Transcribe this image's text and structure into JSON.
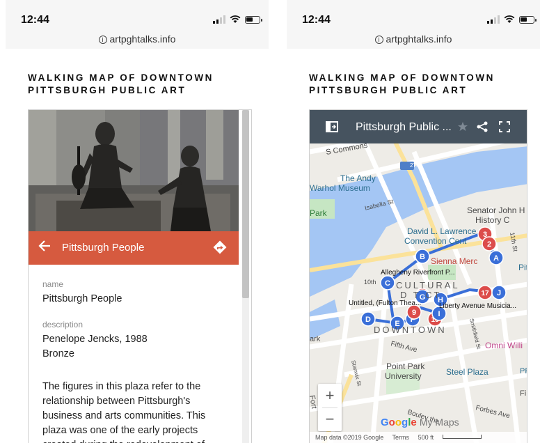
{
  "status": {
    "time": "12:44",
    "url": "artpghtalks.info"
  },
  "page": {
    "heading": "WALKING MAP OF DOWNTOWN PITTSBURGH PUBLIC ART"
  },
  "card": {
    "title": "Pittsburgh People",
    "name_label": "name",
    "name_value": "Pittsburgh People",
    "description_label": "description",
    "description_line1": "Penelope Jencks, 1988",
    "description_line2": "Bronze",
    "description_text": "The figures in this plaza refer to the relationship between Pittsburgh's business and arts communities. This plaza was one of the early projects created during the redevelopment of"
  },
  "map": {
    "title": "Pittsburgh Public ...",
    "attribution": "Map data ©2019 Google",
    "terms": "Terms",
    "scale": "500 ft",
    "google": "Google",
    "my_maps": "My Maps",
    "zoom_in": "+",
    "zoom_out": "−",
    "labels": {
      "s_commons": "S Commons",
      "andy_warhol": "The Andy",
      "andy_warhol2": "Warhol Museum",
      "isabella": "Isabella St",
      "park": "Park",
      "senator": "Senator John H",
      "history": "History C",
      "convention1": "David L. Lawrence",
      "convention2": "Convention Cent",
      "sienna": "Sienna Merc",
      "allegheny": "Allegheny Riverfront P...",
      "cultural1": "CULTURAL",
      "cultural2": "D  T  CT",
      "tenth": "10th",
      "untitled": "Untitled, (Fulton Thea...",
      "liberty": "Liberty Avenue Musicia...",
      "downtown": "DOWNTOWN",
      "fifth": "Fifth Ave",
      "omni": "Omni Willi",
      "point_park1": "Point Park",
      "point_park2": "University",
      "steel_plaza": "Steel Plaza",
      "forbes": "Forbes Ave",
      "boulevard": "Boulev  the",
      "eleventh": "11th St",
      "pit": "Pit",
      "fort": "Fort",
      "ark": "ark",
      "pp": "PP",
      "fi": "Fi",
      "route": "279",
      "smithfield": "Smithfield St",
      "stanwix": "Stanwix St"
    },
    "markers": [
      {
        "label": "3",
        "kind": "red"
      },
      {
        "label": "2",
        "kind": "red"
      },
      {
        "label": "A",
        "kind": "blue"
      },
      {
        "label": "B",
        "kind": "blue"
      },
      {
        "label": "C",
        "kind": "blue"
      },
      {
        "label": "9",
        "kind": "red"
      },
      {
        "label": "G",
        "kind": "blue"
      },
      {
        "label": "H",
        "kind": "blue"
      },
      {
        "label": "17",
        "kind": "red"
      },
      {
        "label": "J",
        "kind": "blue"
      },
      {
        "label": "D",
        "kind": "blue"
      },
      {
        "label": "E",
        "kind": "blue"
      },
      {
        "label": "F",
        "kind": "blue"
      },
      {
        "label": "9",
        "kind": "red"
      },
      {
        "label": "15",
        "kind": "red"
      },
      {
        "label": "I",
        "kind": "blue"
      }
    ]
  },
  "colors": {
    "accent_red": "#d65a3f",
    "toolbar": "#46535f",
    "river": "#a4c6f4",
    "marker_blue": "#3a6fd8",
    "marker_red": "#dc4c4a"
  }
}
